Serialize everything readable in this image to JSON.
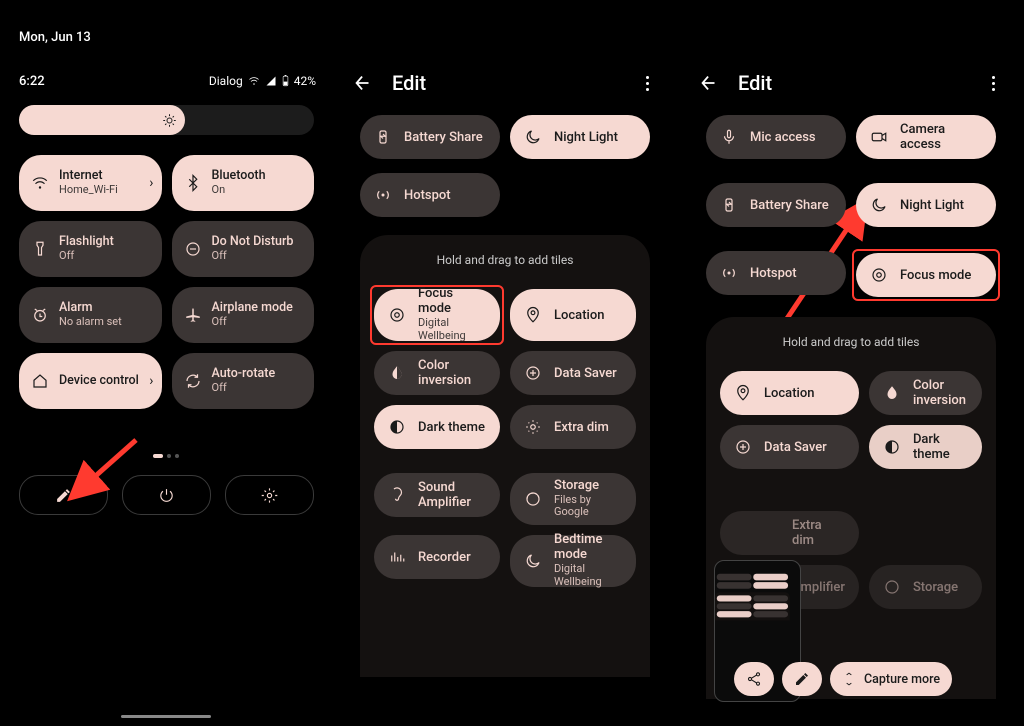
{
  "date": "Mon, Jun 13",
  "status": {
    "time": "6:22",
    "carrier": "Dialog",
    "battery": "42%"
  },
  "qs": {
    "internet": {
      "t": "Internet",
      "s": "Home_Wi-Fi"
    },
    "bluetooth": {
      "t": "Bluetooth",
      "s": "On"
    },
    "flashlight": {
      "t": "Flashlight",
      "s": "Off"
    },
    "dnd": {
      "t": "Do Not Disturb",
      "s": "Off"
    },
    "alarm": {
      "t": "Alarm",
      "s": "No alarm set"
    },
    "airplane": {
      "t": "Airplane mode",
      "s": "Off"
    },
    "device": {
      "t": "Device control"
    },
    "rotate": {
      "t": "Auto-rotate",
      "s": "Off"
    }
  },
  "edit_title": "Edit",
  "hint": "Hold and drag to add tiles",
  "col2": {
    "battery_share": "Battery Share",
    "night_light": "Night Light",
    "hotspot": "Hotspot",
    "focus": {
      "t": "Focus mode",
      "s": "Digital Wellbeing"
    },
    "location": "Location",
    "color_inv": "Color inversion",
    "data_saver": "Data Saver",
    "dark_theme": "Dark theme",
    "extra_dim": "Extra dim",
    "sound_amp": "Sound Amplifier",
    "storage": {
      "t": "Storage",
      "s": "Files by Google"
    },
    "recorder": "Recorder",
    "bedtime": {
      "t": "Bedtime mode",
      "s": "Digital Wellbeing"
    }
  },
  "col3": {
    "mic": "Mic access",
    "camera": "Camera access",
    "battery_share": "Battery Share",
    "night_light": "Night Light",
    "hotspot": "Hotspot",
    "focus": "Focus mode",
    "location": "Location",
    "color_inv": "Color inversion",
    "data_saver": "Data Saver",
    "dark_theme": "Dark theme",
    "extra_dim": "Extra dim",
    "amplifier": "Amplifier",
    "storage": "Storage"
  },
  "capture_more": "Capture more"
}
